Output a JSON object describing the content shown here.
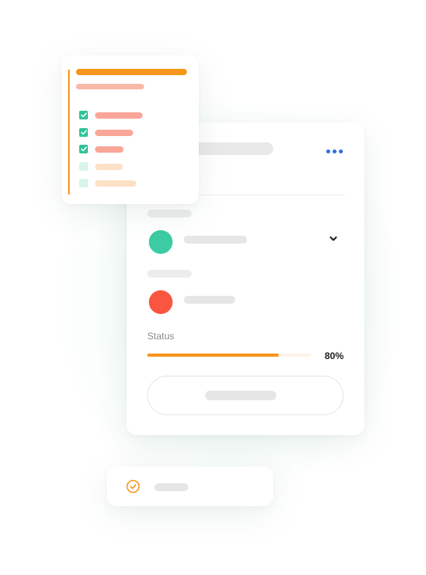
{
  "main_card": {
    "status_label": "Status",
    "progress": {
      "value": 0.8,
      "label": "80%"
    }
  },
  "colors": {
    "accent_orange": "#f7961d",
    "accent_blue": "#2f6fe4",
    "green": "#3ccba2",
    "red": "#fa5541",
    "skeleton": "#e9e9ea"
  },
  "icons": {
    "more": "more-horizontal-icon",
    "chevron": "chevron-down-icon",
    "check": "check-icon",
    "check_circle": "check-circle-icon"
  },
  "checklist": {
    "items": [
      {
        "checked": true
      },
      {
        "checked": true
      },
      {
        "checked": true
      },
      {
        "checked": false
      },
      {
        "checked": false
      }
    ]
  }
}
